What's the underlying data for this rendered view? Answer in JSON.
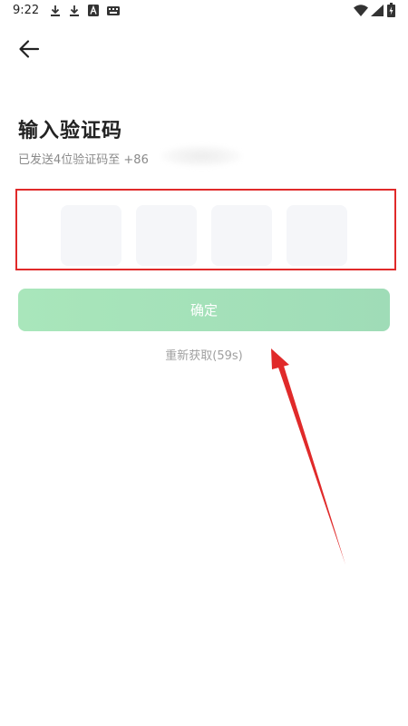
{
  "status_bar": {
    "time": "9:22",
    "icons": [
      "download-icon",
      "download-icon",
      "font-icon",
      "keyboard-icon",
      "wifi-icon",
      "signal-icon",
      "battery-icon"
    ]
  },
  "header": {
    "back_icon": "arrow-left-icon"
  },
  "main": {
    "title": "输入验证码",
    "sent_hint": "已发送4位验证码至 +86",
    "code_cells": [
      "",
      "",
      "",
      ""
    ],
    "confirm_label": "确定",
    "resend_label": "重新获取(59s)"
  },
  "colors": {
    "annotation_red": "#e02a2a",
    "confirm_green": "#a9e6bb",
    "cell_bg": "#f5f6f9"
  }
}
